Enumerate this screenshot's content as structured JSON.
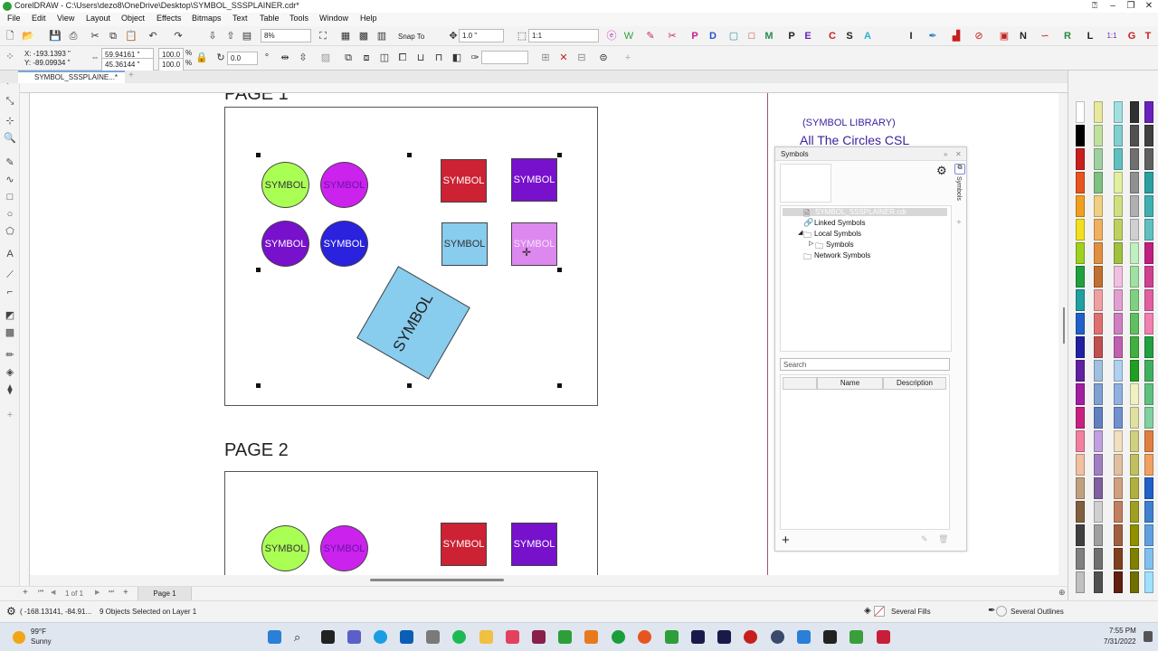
{
  "window": {
    "title": "CorelDRAW - C:\\Users\\dezo8\\OneDrive\\Desktop\\SYMBOL_SSSPLAINER.cdr*"
  },
  "menu": [
    "File",
    "Edit",
    "View",
    "Layout",
    "Object",
    "Effects",
    "Bitmaps",
    "Text",
    "Table",
    "Tools",
    "Window",
    "Help"
  ],
  "toolbar": {
    "zoom": "8%",
    "snap_to": "Snap To",
    "nudge": "1.0 \"",
    "scale": "1:1",
    "x": "X: -193.1393 \"",
    "y": "Y: -89.09934 \"",
    "width": "59.94161 \"",
    "height": "45.36144 \"",
    "scale_x": "100.0",
    "scale_y": "100.0",
    "percent": "%",
    "rotation": "0.0"
  },
  "doc_tab": "SYMBOL_SSSPLAINE...*",
  "ruler_units": "inches",
  "canvas": {
    "page1_title": "PAGE 1",
    "page2_title": "PAGE 2",
    "library_text1": "(SYMBOL LIBRARY)",
    "library_text2": "All The Circles CSL",
    "symbol_label": "SYMBOL",
    "colors": {
      "green": "#aaff55",
      "magenta": "#cc22ee",
      "purple": "#7711cc",
      "blue": "#2a22dd",
      "red": "#cc2233",
      "violet": "#7711cc",
      "sky": "#88ccee",
      "pink": "#dd88ee"
    }
  },
  "symbols_panel": {
    "title": "Symbols",
    "tree": {
      "file": "SYMBOL_SSSPLAINER.cdr",
      "linked": "Linked Symbols",
      "local": "Local Symbols",
      "symbols": "Symbols",
      "network": "Network Symbols"
    },
    "search_placeholder": "Search",
    "columns": [
      "Name",
      "Description"
    ],
    "side_tab": "Symbols"
  },
  "pagebar": {
    "counter": "1 of 1",
    "page_tab": "Page 1"
  },
  "status": {
    "coords": "( -168.13141, -84.91...",
    "selection": "9 Objects Selected on Layer 1",
    "fill": "Several Fills",
    "outline": "Several Outlines"
  },
  "taskbar": {
    "temp": "99°F",
    "weather": "Sunny",
    "time": "7:55 PM",
    "date": "7/31/2022"
  }
}
